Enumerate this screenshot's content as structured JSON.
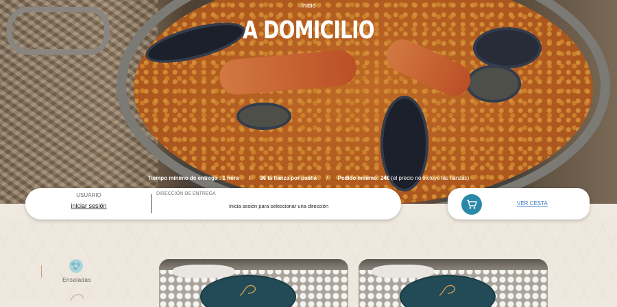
{
  "hero": {
    "breadcrumb": "Inicio",
    "title": "A DOMICILIO",
    "delivery_time_label": "Tiempo mínimo de entrega : 1 hora",
    "deposit_label": "3€ la fianza por paella",
    "min_order_label": "Pedido mínimo: 24€",
    "min_order_note": "(el precio no incluye las fianzas)",
    "separator": "/"
  },
  "address_card": {
    "user_label": "USUARIO",
    "login_link": "iniciar sesión",
    "address_label": "DIRECCIÓN DE ENTREGA",
    "address_message": "Inicia sesión para seleccionar una dirección"
  },
  "cart": {
    "link_label": "VER CESTA",
    "icon": "cart-icon",
    "icon_bg": "#2a89a8"
  },
  "categories": [
    {
      "label": "Ensaladas",
      "icon": "salad-icon"
    }
  ],
  "colors": {
    "accent": "#2a89a8",
    "link": "#3b7ec4",
    "coaster": "#234a57"
  }
}
